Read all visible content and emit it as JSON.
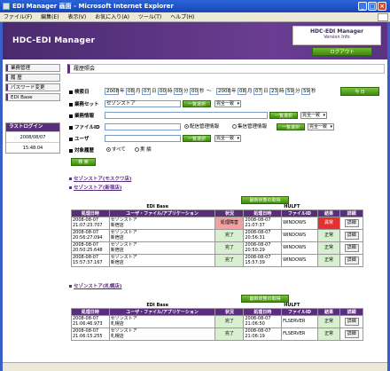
{
  "window": {
    "title": "EDI Manager 画面 - Microsoft Internet Explorer"
  },
  "menu": [
    "ファイル(F)",
    "編集(E)",
    "表示(V)",
    "お気に入り(A)",
    "ツール(T)",
    "ヘルプ(H)"
  ],
  "header": {
    "app_title": "HDC-EDI Manager",
    "version_title": "HDC-EDI Manager",
    "version_sub": "Version Info",
    "logout": "ログアウト"
  },
  "sidebar": {
    "items": [
      "業務管理",
      "履 歴",
      "パスワード変更",
      "EDI Base"
    ],
    "last_login_label": "ラストログイン",
    "last_login_date": "2008/08/07",
    "last_login_time": "15:48:04"
  },
  "page_title": "履歴照会",
  "form": {
    "search_date_label": "検索日",
    "date_from": {
      "y": "2008",
      "y_u": "年",
      "m": "08",
      "m_u": "月",
      "d": "07",
      "d_u": "日",
      "h": "00",
      "h_u": "時",
      "mi": "00",
      "mi_u": "分",
      "s": "00",
      "s_u": "秒"
    },
    "range_sep": "～",
    "date_to": {
      "y": "2008",
      "y_u": "年",
      "m": "08",
      "m_u": "月",
      "d": "07",
      "d_u": "日",
      "h": "23",
      "h_u": "時",
      "mi": "59",
      "mi_u": "分",
      "s": "59",
      "s_u": "秒"
    },
    "today": "今 日",
    "business_set_label": "業務セット",
    "business_set_value": "セゾンストア",
    "business_info_label": "業務情報",
    "file_id_label": "ファイルID",
    "user_label": "ユーザ",
    "target_history_label": "対象履歴",
    "list_select": "一覧選択",
    "match_full": "完全一致",
    "radio_delivery": "配信管理情報",
    "radio_collect": "集信管理情報",
    "radio_all": "すべて",
    "radio_real": "実 績",
    "search": "検 索"
  },
  "links": {
    "store1": "セゾンストア(モスクワ店)",
    "store2": "セゾンストア(新宿店)",
    "store3": "セゾンストア(札幌店)"
  },
  "refresh_label": "最新状態の取得",
  "table_headers": {
    "group_edi": "EDI Base",
    "group_hulft": "HULFT",
    "proc_time": "処理日時",
    "user_file_app": "ユーザ・ファイル/アプリケーション",
    "status": "状況",
    "file_id": "ファイルID",
    "result": "結果",
    "detail": "詳細"
  },
  "table1": [
    {
      "t1": "2008-08-07 21:07:23.707",
      "user": "セゾンストア",
      "store": "新宿店",
      "status": "処理障害",
      "t2": "2008-08-07 21:07:37",
      "fid": "WINDOWS",
      "result": "異常",
      "detail": "詳細"
    },
    {
      "t1": "2008-08-07 20:56:27.094",
      "user": "セゾンストア",
      "store": "新宿店",
      "status": "完了",
      "t2": "2008-08-07 20:56:31",
      "fid": "WINDOWS",
      "result": "正常",
      "detail": "詳細"
    },
    {
      "t1": "2008-08-07 20:50:25.648",
      "user": "セゾンストア",
      "store": "新宿店",
      "status": "完了",
      "t2": "2008-08-07 20:50:29",
      "fid": "WINDOWS",
      "result": "正常",
      "detail": "詳細"
    },
    {
      "t1": "2008-08-07 15:57:37.167",
      "user": "セゾンストア",
      "store": "新宿店",
      "status": "完了",
      "t2": "2008-08-07 15:57:39",
      "fid": "WINDOWS",
      "result": "正常",
      "detail": "詳細"
    }
  ],
  "table2": [
    {
      "t1": "2008-08-07 21:06:46.973",
      "user": "セゾンストア",
      "store": "札幌店",
      "status": "完了",
      "t2": "2008-08-07 21:06:50",
      "fid": "FLSERVER",
      "result": "正常",
      "detail": "詳細"
    },
    {
      "t1": "2008-08-07 21:06:15.255",
      "user": "セゾンストア",
      "store": "札幌店",
      "status": "完了",
      "t2": "2008-08-07 21:06:19",
      "fid": "FLSERVER",
      "result": "正常",
      "detail": "詳細"
    }
  ],
  "colors": {
    "accent": "#5b2e7c",
    "green": "#3f8a10",
    "error": "#f4a0a0",
    "ng": "#e53030",
    "ok": "#d8f0d0"
  }
}
